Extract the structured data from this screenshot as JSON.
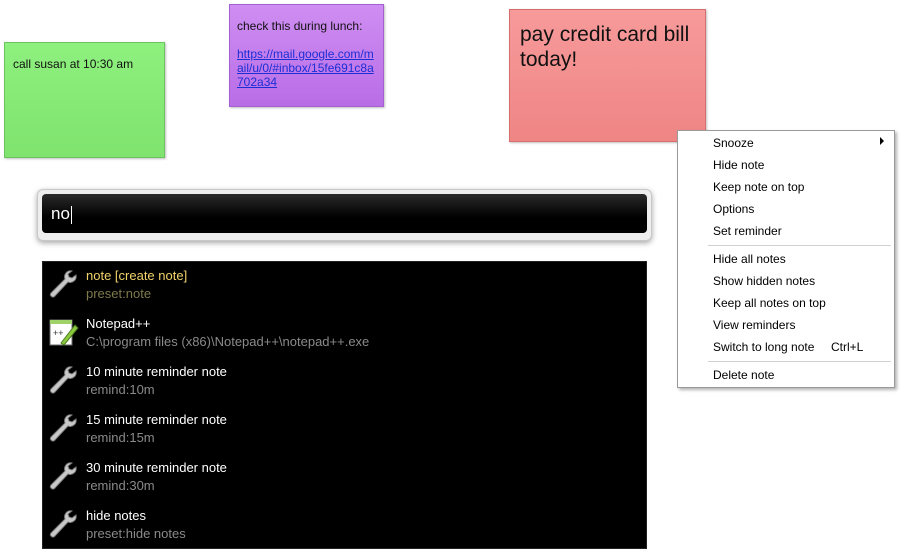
{
  "notes": {
    "green": {
      "text": "call susan at 10:30 am",
      "color": "#8ef07e"
    },
    "purple": {
      "text": "check this during lunch:",
      "link": "https://mail.google.com/mail/u/0/#inbox/15fe691c8a702a34",
      "color": "#c57deb"
    },
    "red": {
      "text": "pay credit card bill today!",
      "color": "#f28f8f"
    }
  },
  "search": {
    "value": "no"
  },
  "results": [
    {
      "title": "note [create note]",
      "subtitle": "preset:note",
      "icon": "wrench-icon"
    },
    {
      "title": "Notepad++",
      "subtitle": "C:\\program files (x86)\\Notepad++\\notepad++.exe",
      "icon": "notepad-plus-plus-icon"
    },
    {
      "title": "10 minute reminder note",
      "subtitle": "remind:10m",
      "icon": "wrench-icon"
    },
    {
      "title": "15 minute reminder note",
      "subtitle": "remind:15m",
      "icon": "wrench-icon"
    },
    {
      "title": "30 minute reminder note",
      "subtitle": "remind:30m",
      "icon": "wrench-icon"
    },
    {
      "title": "hide notes",
      "subtitle": "preset:hide notes",
      "icon": "wrench-icon"
    }
  ],
  "context_menu": {
    "snooze": "Snooze",
    "hide_note": "Hide note",
    "keep_on_top": "Keep note on top",
    "options": "Options",
    "set_reminder": "Set reminder",
    "hide_all": "Hide all notes",
    "show_hidden": "Show hidden notes",
    "keep_all_on_top": "Keep all notes on top",
    "view_reminders": "View reminders",
    "switch_long": "Switch to long note",
    "switch_long_shortcut": "Ctrl+L",
    "delete": "Delete note"
  }
}
